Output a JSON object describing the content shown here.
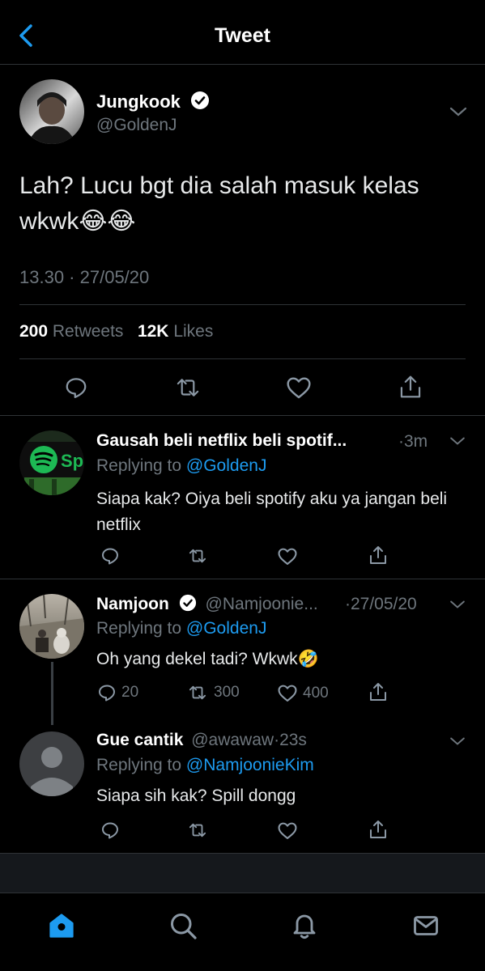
{
  "header": {
    "title": "Tweet"
  },
  "tweet": {
    "name": "Jungkook",
    "handle": "@GoldenJ",
    "text_line1": "Lah? Lucu bgt dia salah masuk kelas",
    "text_line2": "wkwk",
    "emoji": "😂😂",
    "time": "13.30",
    "date": "27/05/20",
    "retweets_count": "200",
    "retweets_label": "Retweets",
    "likes_count": "12K",
    "likes_label": "Likes"
  },
  "replies": [
    {
      "name": "Gausah beli netflix beli spotif...",
      "handle": "",
      "time": "·3m",
      "replying_label": "Replying to",
      "replying_to": "@GoldenJ",
      "text": "Siapa kak? Oiya beli spotify aku ya jangan beli netflix",
      "avatar_text": "Sp",
      "reply_count": "",
      "retweet_count": "",
      "like_count": ""
    },
    {
      "name": "Namjoon",
      "handle": "@Namjoonie...",
      "time": "·27/05/20",
      "replying_label": "Replying to",
      "replying_to": "@GoldenJ",
      "text": "Oh yang dekel tadi? Wkwk",
      "emoji": "🤣",
      "reply_count": "20",
      "retweet_count": "300",
      "like_count": "400"
    },
    {
      "name": "Gue cantik",
      "handle": "@awawaw",
      "time": "·23s",
      "replying_label": "Replying to",
      "replying_to": "@NamjoonieKim",
      "text": "Siapa sih kak? Spill dongg",
      "reply_count": "",
      "retweet_count": "",
      "like_count": ""
    }
  ],
  "colors": {
    "accent": "#1d9bf0",
    "muted": "#6e767d",
    "spotify": "#1db954"
  },
  "icons": [
    "back-arrow-icon",
    "verified-icon",
    "chevron-down-icon",
    "reply-icon",
    "retweet-icon",
    "like-icon",
    "share-icon",
    "home-icon",
    "search-icon",
    "notifications-icon",
    "messages-icon"
  ]
}
